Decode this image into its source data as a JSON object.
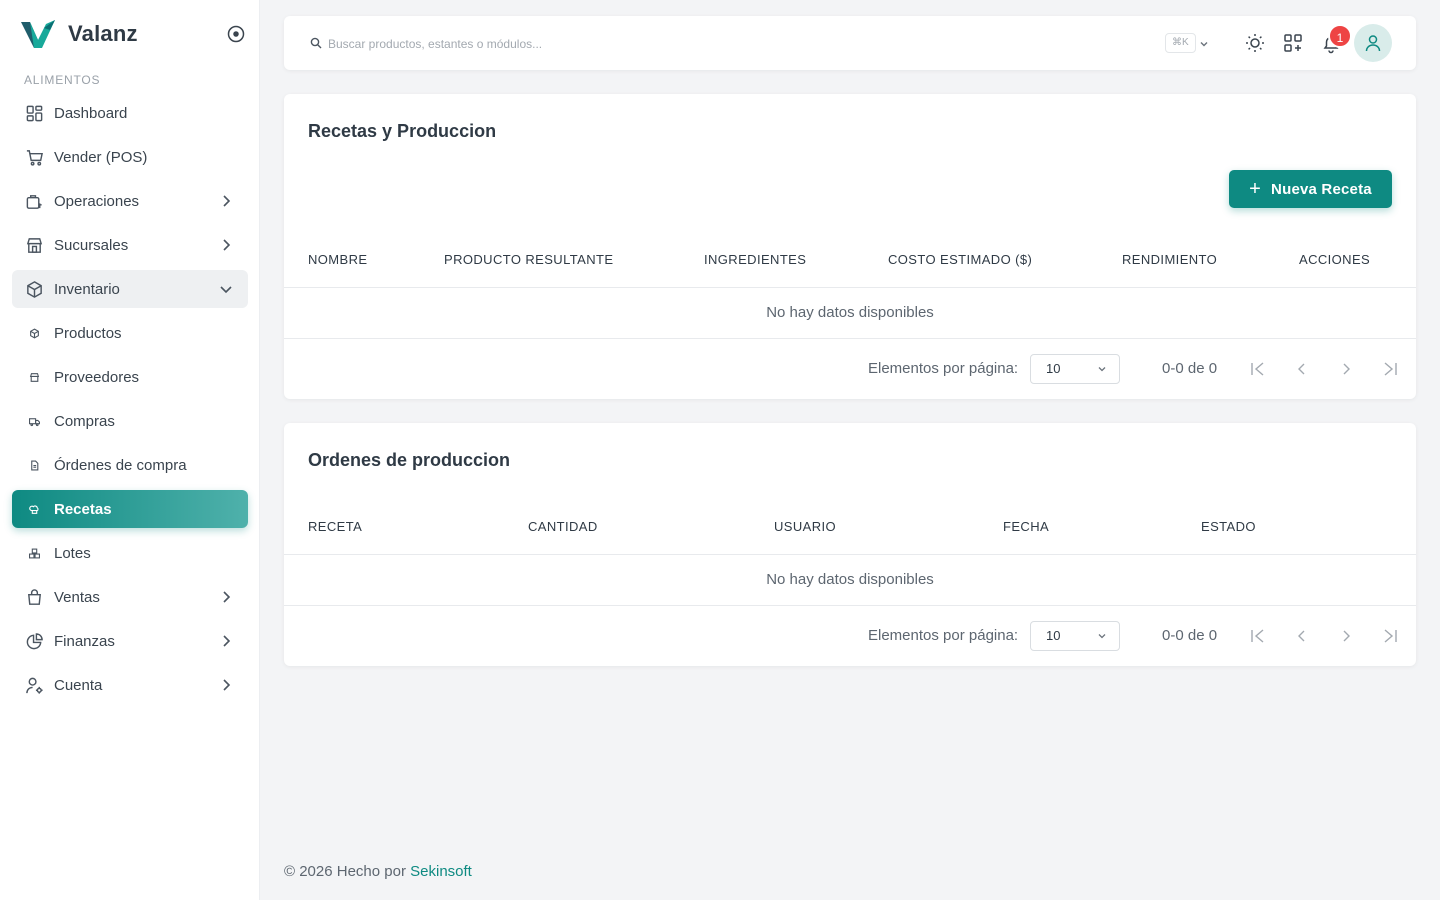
{
  "app": {
    "name": "Valanz"
  },
  "sidebar": {
    "section": "ALIMENTOS",
    "items": [
      {
        "label": "Dashboard",
        "icon": "dashboard-grid-icon"
      },
      {
        "label": "Vender (POS)",
        "icon": "cart-icon"
      },
      {
        "label": "Operaciones",
        "icon": "briefcase-icon"
      },
      {
        "label": "Sucursales",
        "icon": "store-icon"
      },
      {
        "label": "Inventario",
        "icon": "box-icon"
      },
      {
        "label": "Productos",
        "icon": "box-small-icon"
      },
      {
        "label": "Proveedores",
        "icon": "store-small-icon"
      },
      {
        "label": "Compras",
        "icon": "truck-icon"
      },
      {
        "label": "Órdenes de compra",
        "icon": "document-icon"
      },
      {
        "label": "Recetas",
        "icon": "chef-hat-icon"
      },
      {
        "label": "Lotes",
        "icon": "boxes-icon"
      },
      {
        "label": "Ventas",
        "icon": "shopping-bag-icon"
      },
      {
        "label": "Finanzas",
        "icon": "pie-chart-icon"
      },
      {
        "label": "Cuenta",
        "icon": "user-settings-icon"
      }
    ]
  },
  "topbar": {
    "search_placeholder": "Buscar productos, estantes o módulos...",
    "shortcut": "⌘K",
    "notifications_count": "1"
  },
  "recipes": {
    "title": "Recetas y Produccion",
    "new_button": "Nueva Receta",
    "columns": [
      "NOMBRE",
      "PRODUCTO RESULTANTE",
      "INGREDIENTES",
      "COSTO ESTIMADO ($)",
      "RENDIMIENTO",
      "ACCIONES"
    ],
    "empty": "No hay datos disponibles",
    "paginator": {
      "label": "Elementos por página:",
      "page_size": "10",
      "range": "0-0 de 0"
    }
  },
  "orders": {
    "title": "Ordenes de produccion",
    "columns": [
      "RECETA",
      "CANTIDAD",
      "USUARIO",
      "FECHA",
      "ESTADO"
    ],
    "empty": "No hay datos disponibles",
    "paginator": {
      "label": "Elementos por página:",
      "page_size": "10",
      "range": "0-0 de 0"
    }
  },
  "footer": {
    "text": "© 2026 Hecho por",
    "brand": "Sekinsoft"
  },
  "colors": {
    "accent": "#0e8a82",
    "accent_light": "#4fb1ab",
    "badge": "#ee4444"
  }
}
